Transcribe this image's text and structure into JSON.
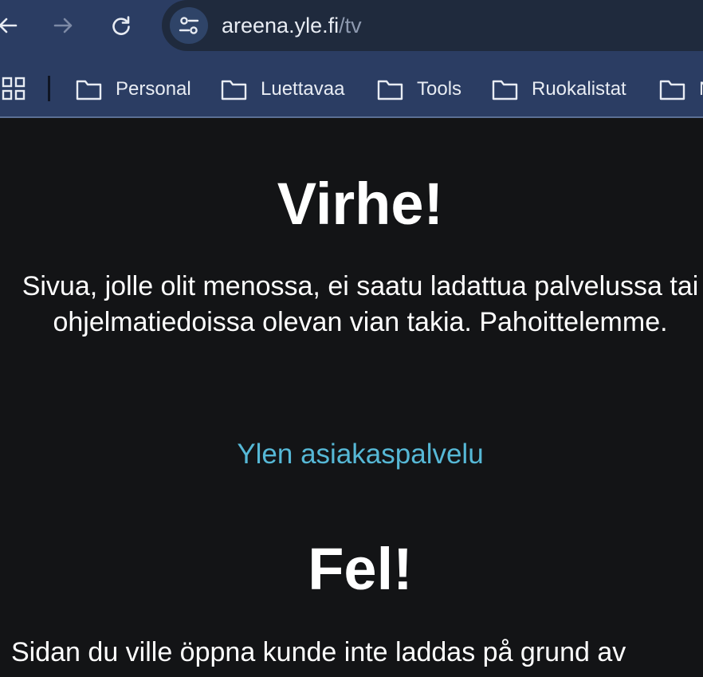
{
  "browser": {
    "url_host": "areena.yle.fi",
    "url_path": "/tv",
    "bookmarks": [
      {
        "label": "Personal"
      },
      {
        "label": "Luettavaa"
      },
      {
        "label": "Tools"
      },
      {
        "label": "Ruokalistat"
      },
      {
        "label": "N"
      }
    ]
  },
  "page": {
    "fi": {
      "heading": "Virhe!",
      "message": "Sivua, jolle olit menossa, ei saatu ladattua palvelussa tai ohjelmatiedoissa olevan vian takia. Pahoittelemme.",
      "link": "Ylen asiakaspalvelu"
    },
    "sv": {
      "heading": "Fel!",
      "message": "Sidan du ville öppna kunde inte laddas på grund av"
    }
  },
  "colors": {
    "toolbar_bg": "#2b3d63",
    "omnibox_bg": "#1f2a3d",
    "page_bg": "#131416",
    "link": "#56b8d6"
  },
  "icons": [
    "back-arrow-icon",
    "forward-arrow-icon",
    "reload-icon",
    "site-settings-icon",
    "apps-grid-icon",
    "folder-icon"
  ]
}
